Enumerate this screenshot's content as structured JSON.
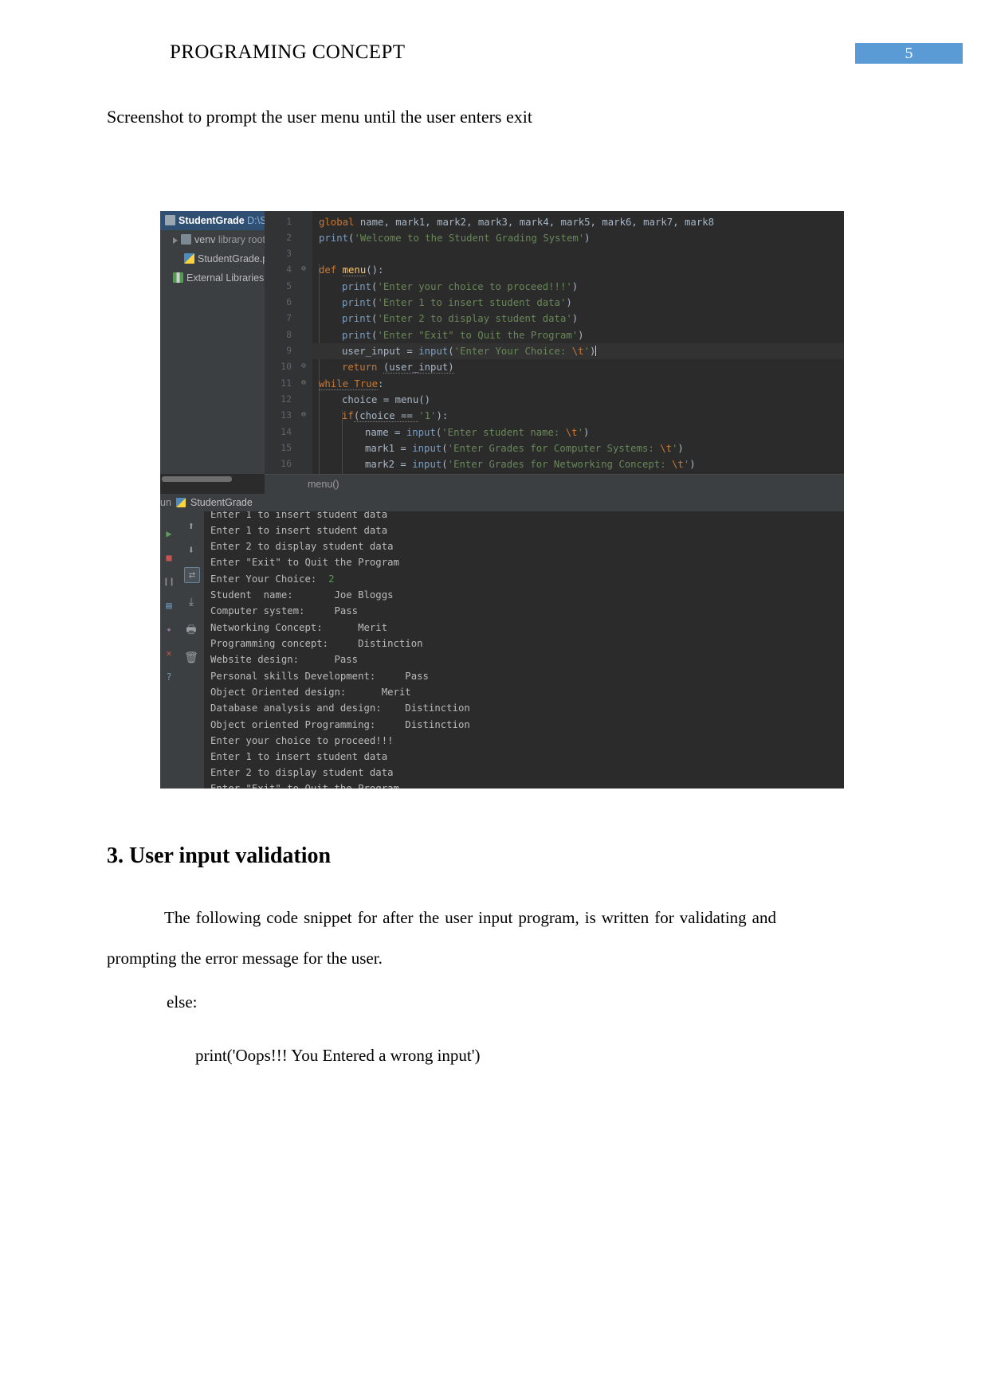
{
  "header": {
    "title": "PROGRAMING CONCEPT",
    "page_number": "5",
    "badge_color": "#5b9bd5"
  },
  "document": {
    "caption": "Screenshot to prompt the user menu until the user enters exit",
    "section_heading": "3. User input validation",
    "paragraph": "The following code snippet for after the user input program, is written for validating and prompting the error message for the user.",
    "code_snippet_line_1": "else:",
    "code_snippet_line_2": "print('Oops!!! You Entered a wrong input')"
  },
  "ide": {
    "project_panel": {
      "items": [
        {
          "label": "StudentGrade",
          "hint": "D:\\Stu",
          "icon": "folder-icon",
          "selected": true
        },
        {
          "label": "venv",
          "hint": "library root",
          "icon": "folder-icon",
          "selected": false
        },
        {
          "label": "StudentGrade.py",
          "hint": "",
          "icon": "python-file-icon",
          "selected": false
        },
        {
          "label": "External Libraries",
          "hint": "",
          "icon": "libraries-icon",
          "selected": false
        }
      ]
    },
    "editor": {
      "breadcrumb": "menu()",
      "gutter_numbers": [
        "1",
        "2",
        "3",
        "4",
        "5",
        "6",
        "7",
        "8",
        "9",
        "10",
        "11",
        "12",
        "13",
        "14",
        "15",
        "16"
      ],
      "lines": [
        {
          "n": 1,
          "indent": 0,
          "tokens": [
            {
              "t": "global",
              "c": "kw"
            },
            {
              "t": " name, mark1, mark2, mark3, mark4, mark5, mark6, mark7, mark8",
              "c": "plain"
            }
          ]
        },
        {
          "n": 2,
          "indent": 0,
          "tokens": [
            {
              "t": "print",
              "c": "fn"
            },
            {
              "t": "(",
              "c": "plain"
            },
            {
              "t": "'Welcome to the Student Grading System'",
              "c": "str"
            },
            {
              "t": ")",
              "c": "plain"
            }
          ]
        },
        {
          "n": 3,
          "indent": 0,
          "tokens": []
        },
        {
          "n": 4,
          "indent": 0,
          "tokens": [
            {
              "t": "def ",
              "c": "kw"
            },
            {
              "t": "menu",
              "c": "met"
            },
            {
              "t": "():",
              "c": "plain"
            }
          ]
        },
        {
          "n": 5,
          "indent": 1,
          "tokens": [
            {
              "t": "print",
              "c": "fn"
            },
            {
              "t": "(",
              "c": "plain"
            },
            {
              "t": "'Enter your choice to proceed!!!'",
              "c": "str"
            },
            {
              "t": ")",
              "c": "plain"
            }
          ]
        },
        {
          "n": 6,
          "indent": 1,
          "tokens": [
            {
              "t": "print",
              "c": "fn"
            },
            {
              "t": "(",
              "c": "plain"
            },
            {
              "t": "'Enter 1 to insert student data'",
              "c": "str"
            },
            {
              "t": ")",
              "c": "plain"
            }
          ]
        },
        {
          "n": 7,
          "indent": 1,
          "tokens": [
            {
              "t": "print",
              "c": "fn"
            },
            {
              "t": "(",
              "c": "plain"
            },
            {
              "t": "'Enter 2 to display student data'",
              "c": "str"
            },
            {
              "t": ")",
              "c": "plain"
            }
          ]
        },
        {
          "n": 8,
          "indent": 1,
          "tokens": [
            {
              "t": "print",
              "c": "fn"
            },
            {
              "t": "(",
              "c": "plain"
            },
            {
              "t": "'Enter \"Exit\" to Quit the Program'",
              "c": "str"
            },
            {
              "t": ")",
              "c": "plain"
            }
          ]
        },
        {
          "n": 9,
          "indent": 1,
          "tokens": [
            {
              "t": "user_input = ",
              "c": "plain"
            },
            {
              "t": "input",
              "c": "fn"
            },
            {
              "t": "(",
              "c": "plain"
            },
            {
              "t": "'Enter Your Choice: ",
              "c": "str"
            },
            {
              "t": "\\t",
              "c": "esc"
            },
            {
              "t": "'",
              "c": "str"
            },
            {
              "t": ")",
              "c": "plain"
            }
          ]
        },
        {
          "n": 10,
          "indent": 1,
          "tokens": [
            {
              "t": "return ",
              "c": "kw"
            },
            {
              "t": "(user_input)",
              "c": "plain"
            }
          ]
        },
        {
          "n": 11,
          "indent": 0,
          "tokens": [
            {
              "t": "while True",
              "c": "kw"
            },
            {
              "t": ":",
              "c": "plain"
            }
          ]
        },
        {
          "n": 12,
          "indent": 1,
          "tokens": [
            {
              "t": "choice = menu()",
              "c": "plain"
            }
          ]
        },
        {
          "n": 13,
          "indent": 1,
          "tokens": [
            {
              "t": "if",
              "c": "kw"
            },
            {
              "t": "(choice == ",
              "c": "plain"
            },
            {
              "t": "'1'",
              "c": "str"
            },
            {
              "t": "):",
              "c": "plain"
            }
          ]
        },
        {
          "n": 14,
          "indent": 2,
          "tokens": [
            {
              "t": "name = ",
              "c": "plain"
            },
            {
              "t": "input",
              "c": "fn"
            },
            {
              "t": "(",
              "c": "plain"
            },
            {
              "t": "'Enter student name: ",
              "c": "str"
            },
            {
              "t": "\\t",
              "c": "esc"
            },
            {
              "t": "'",
              "c": "str"
            },
            {
              "t": ")",
              "c": "plain"
            }
          ]
        },
        {
          "n": 15,
          "indent": 2,
          "tokens": [
            {
              "t": "mark1 = ",
              "c": "plain"
            },
            {
              "t": "input",
              "c": "fn"
            },
            {
              "t": "(",
              "c": "plain"
            },
            {
              "t": "'Enter Grades for Computer Systems: ",
              "c": "str"
            },
            {
              "t": "\\t",
              "c": "esc"
            },
            {
              "t": "'",
              "c": "str"
            },
            {
              "t": ")",
              "c": "plain"
            }
          ]
        },
        {
          "n": 16,
          "indent": 2,
          "tokens": [
            {
              "t": "mark2 = ",
              "c": "plain"
            },
            {
              "t": "input",
              "c": "fn"
            },
            {
              "t": "(",
              "c": "plain"
            },
            {
              "t": "'Enter Grades for Networking Concept: ",
              "c": "str"
            },
            {
              "t": "\\t",
              "c": "esc"
            },
            {
              "t": "'",
              "c": "str"
            },
            {
              "t": ")",
              "c": "plain"
            }
          ]
        }
      ]
    },
    "run_panel": {
      "tab_prefix": "un",
      "tab_label": "StudentGrade",
      "console_lines": [
        {
          "text": "Enter 1 to insert student data"
        },
        {
          "text": "Enter 2 to display student data"
        },
        {
          "text": "Enter \"Exit\" to Quit the Program"
        },
        {
          "text": "Enter Your Choice:  ",
          "suffix": "2",
          "suffix_color": "green"
        },
        {
          "text": "Student  name:       Joe Bloggs"
        },
        {
          "text": "Computer system:     Pass"
        },
        {
          "text": "Networking Concept:      Merit"
        },
        {
          "text": "Programming concept:     Distinction"
        },
        {
          "text": "Website design:      Pass"
        },
        {
          "text": "Personal skills Development:     Pass"
        },
        {
          "text": "Object Oriented design:      Merit"
        },
        {
          "text": "Database analysis and design:    Distinction"
        },
        {
          "text": "Object oriented Programming:     Distinction"
        },
        {
          "text": "Enter your choice to proceed!!!"
        },
        {
          "text": "Enter 1 to insert student data"
        },
        {
          "text": "Enter 2 to display student data"
        },
        {
          "text": "Enter \"Exit\" to Quit the Program"
        }
      ]
    }
  }
}
